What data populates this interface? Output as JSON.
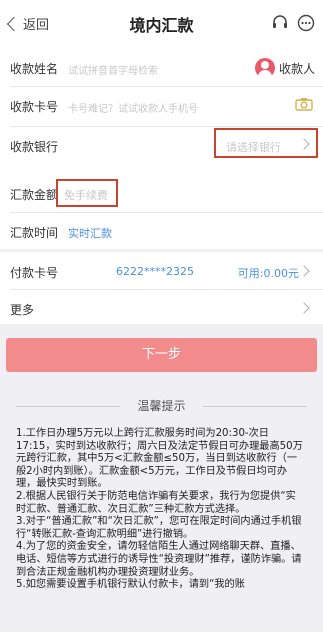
{
  "nav": {
    "back_label": "返回",
    "title": "境内汇款"
  },
  "form": {
    "payee_name": {
      "label": "收款姓名",
      "placeholder": "试试拼音首字母检索",
      "payee_button": "收款人"
    },
    "card_no": {
      "label": "收款卡号",
      "placeholder": "卡号难记？试试收款人手机号"
    },
    "bank": {
      "label": "收款银行",
      "placeholder": "请选择银行"
    },
    "amount": {
      "label": "汇款金额",
      "placeholder": "免手续费"
    },
    "time": {
      "label": "汇款时间",
      "value": "实时汇款"
    },
    "pay_card": {
      "label": "付款卡号",
      "value": "6222****2325",
      "available": "可用:0.00元"
    },
    "more": {
      "label": "更多"
    }
  },
  "next_button": "下一步",
  "tips": {
    "title": "温馨提示",
    "items": [
      "1.工作日办理5万元以上跨行汇款服务时间为20:30-次日17:15，实时到达收款行；周六日及法定节假日可办理最高50万元跨行汇款，其中5万<汇款金额≤50万，当日到达收款行（一般2小时内到账）。汇款金额<5万元，工作日及节假日均可办理，最快实时到账。",
      "2.根据人民银行关于防范电信诈骗有关要求，我行为您提供“实时汇款、普通汇款、次日汇款”三种汇款方式选择。",
      "3.对于“普通汇款”和“次日汇款”，您可在限定时间内通过手机银行“转账汇款-查询汇款明细”进行撤销。",
      "4.为了您的资金安全，请勿轻信陌生人通过网络聊天群、直播、电话、短信等方式进行的诱导性“投资理财”推荐，谨防诈骗。请到合法正规金融机构办理投资理财业务。",
      "5.如您需要设置手机银行默认付款卡，请到“我的账"
    ]
  },
  "colors": {
    "accent_blue": "#4a90e2",
    "button": "#f28c8c",
    "highlight_box": "#c8442f",
    "avatar": "#e85a6a"
  }
}
